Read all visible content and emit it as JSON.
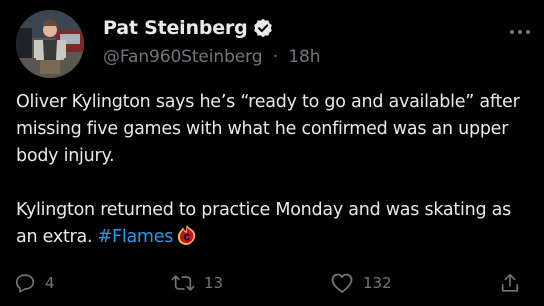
{
  "author": {
    "display_name": "Pat Steinberg",
    "handle": "@Fan960Steinberg",
    "separator": "·",
    "time": "18h"
  },
  "tweet": {
    "paragraph1": "Oliver Kylington says he’s “ready to go and available” after missing five games with what he confirmed was an upper body injury.",
    "paragraph2_text": "Kylington returned to practice Monday and was skating as an extra. ",
    "hashtag": "#Flames"
  },
  "actions": {
    "replies": "4",
    "retweets": "13",
    "likes": "132"
  },
  "icons": {
    "verified": "verified-badge-icon",
    "more": "more-icon",
    "reply": "reply-icon",
    "retweet": "retweet-icon",
    "like": "heart-icon",
    "share": "share-icon",
    "hashflag": "flames-logo-icon"
  },
  "colors": {
    "background": "#000000",
    "text": "#e7e9ea",
    "muted": "#71767b",
    "link": "#1d9bf0",
    "flames_red": "#c8102e",
    "flames_gold": "#f1be48"
  }
}
